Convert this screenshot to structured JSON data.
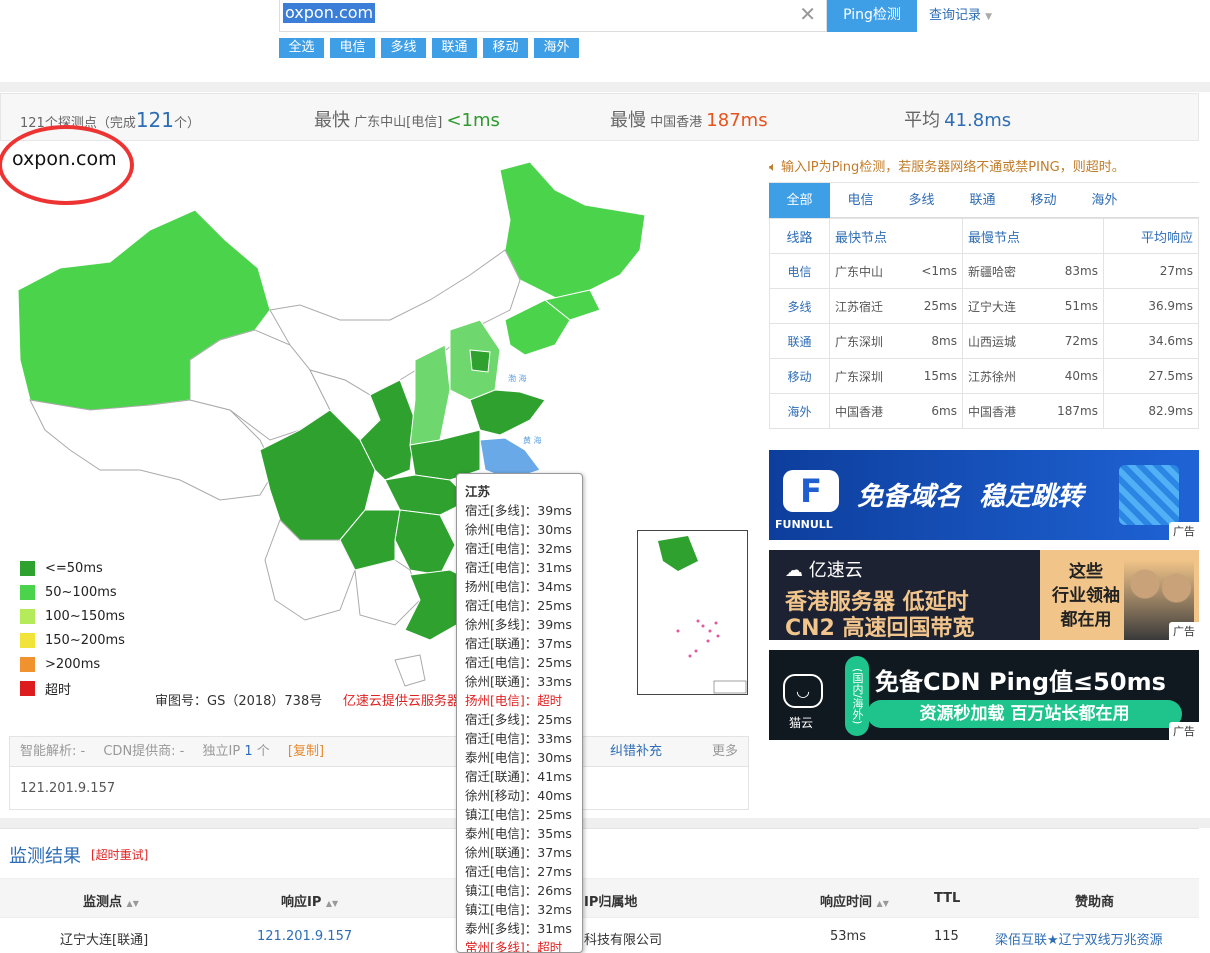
{
  "search": {
    "value": "oxpon.com",
    "clear_icon": "close-icon",
    "button": "Ping检测",
    "history": "查询记录"
  },
  "filters": [
    "全选",
    "电信",
    "多线",
    "联通",
    "移动",
    "海外"
  ],
  "stats": {
    "count_prefix": "121个探测点（完成",
    "count_done": "121",
    "count_suffix": "个）",
    "fastest_label": "最快",
    "fastest_node": "广东中山[电信]",
    "fastest_value": "<1ms",
    "slowest_label": "最慢",
    "slowest_node": "中国香港",
    "slowest_value": "187ms",
    "avg_label": "平均",
    "avg_value": "41.8ms"
  },
  "domain_title": "oxpon.com",
  "legend": [
    {
      "label": "<=50ms",
      "color": "#2ea12e"
    },
    {
      "label": "50~100ms",
      "color": "#4cd34c"
    },
    {
      "label": "100~150ms",
      "color": "#b5ea5a"
    },
    {
      "label": "150~200ms",
      "color": "#f2e33a"
    },
    {
      "label": ">200ms",
      "color": "#f0932e"
    },
    {
      "label": "超时",
      "color": "#dd1d1d"
    }
  ],
  "map_credit": {
    "text": "审图号：GS（2018）738号",
    "provider": "亿速云提供云服务器"
  },
  "info": {
    "smart_dns": "智能解析: -",
    "cdn": "CDN提供商: -",
    "ip_label": "独立IP",
    "ip_count": "1",
    "ip_unit": "个",
    "copy": "[复制]",
    "report": "纠错补充",
    "more": "更多",
    "ip": "121.201.9.157"
  },
  "tooltip": {
    "title": "江苏",
    "rows": [
      {
        "t": "宿迁[多线]：39ms"
      },
      {
        "t": "徐州[电信]：30ms"
      },
      {
        "t": "宿迁[电信]：32ms"
      },
      {
        "t": "宿迁[电信]：31ms"
      },
      {
        "t": "扬州[电信]：34ms"
      },
      {
        "t": "宿迁[电信]：25ms"
      },
      {
        "t": "徐州[多线]：39ms"
      },
      {
        "t": "宿迁[联通]：37ms"
      },
      {
        "t": "宿迁[电信]：25ms"
      },
      {
        "t": "徐州[联通]：33ms"
      },
      {
        "t": "扬州[电信]：超时",
        "timeout": true
      },
      {
        "t": "宿迁[多线]：25ms"
      },
      {
        "t": "宿迁[电信]：33ms"
      },
      {
        "t": "泰州[电信]：30ms"
      },
      {
        "t": "宿迁[联通]：41ms"
      },
      {
        "t": "徐州[移动]：40ms"
      },
      {
        "t": "镇江[电信]：25ms"
      },
      {
        "t": "泰州[电信]：35ms"
      },
      {
        "t": "徐州[联通]：37ms"
      },
      {
        "t": "宿迁[电信]：27ms"
      },
      {
        "t": "镇江[电信]：26ms"
      },
      {
        "t": "镇江[电信]：32ms"
      },
      {
        "t": "泰州[多线]：31ms"
      },
      {
        "t": "常州[多线]：超时",
        "timeout": true
      }
    ]
  },
  "notice": "输入IP为Ping检测，若服务器网络不通或禁PING，则超时。",
  "tabs": [
    "全部",
    "电信",
    "多线",
    "联通",
    "移动",
    "海外"
  ],
  "table": {
    "headers": [
      "线路",
      "最快节点",
      "最慢节点",
      "平均响应"
    ],
    "rows": [
      {
        "line": "电信",
        "fast": "广东中山",
        "fast_v": "<1ms",
        "slow": "新疆哈密",
        "slow_v": "83ms",
        "avg": "27ms"
      },
      {
        "line": "多线",
        "fast": "江苏宿迁",
        "fast_v": "25ms",
        "slow": "辽宁大连",
        "slow_v": "51ms",
        "avg": "36.9ms"
      },
      {
        "line": "联通",
        "fast": "广东深圳",
        "fast_v": "8ms",
        "slow": "山西运城",
        "slow_v": "72ms",
        "avg": "34.6ms"
      },
      {
        "line": "移动",
        "fast": "广东深圳",
        "fast_v": "15ms",
        "slow": "江苏徐州",
        "slow_v": "40ms",
        "avg": "27.5ms"
      },
      {
        "line": "海外",
        "fast": "中国香港",
        "fast_v": "6ms",
        "slow": "中国香港",
        "slow_v": "187ms",
        "avg": "82.9ms"
      }
    ]
  },
  "ads": {
    "tag": "广告",
    "ad1": {
      "brand": "FUNNULL",
      "text": "免备域名  稳定跳转"
    },
    "ad2": {
      "brand": "亿速云",
      "line1": "香港服务器 低延时",
      "line2": "CN2 高速回国带宽",
      "side1": "这些",
      "side2": "行业领袖",
      "side3": "都在用"
    },
    "ad3": {
      "brand": "猫云",
      "vertical": "(国内/海外)",
      "line1": "免备CDN Ping值≤50ms",
      "line2": "资源秒加载 百万站长都在用"
    }
  },
  "results": {
    "title": "监测结果",
    "retry": "[超时重试]",
    "headers": [
      "监测点",
      "响应IP",
      "IP归属地",
      "响应时间",
      "TTL",
      "赞助商"
    ],
    "row": {
      "node": "辽宁大连[联通]",
      "ip": "121.201.9.157",
      "loc": "科技有限公司",
      "time": "53ms",
      "ttl": "115",
      "sponsor": "梁佰互联★辽宁双线万兆资源"
    }
  }
}
